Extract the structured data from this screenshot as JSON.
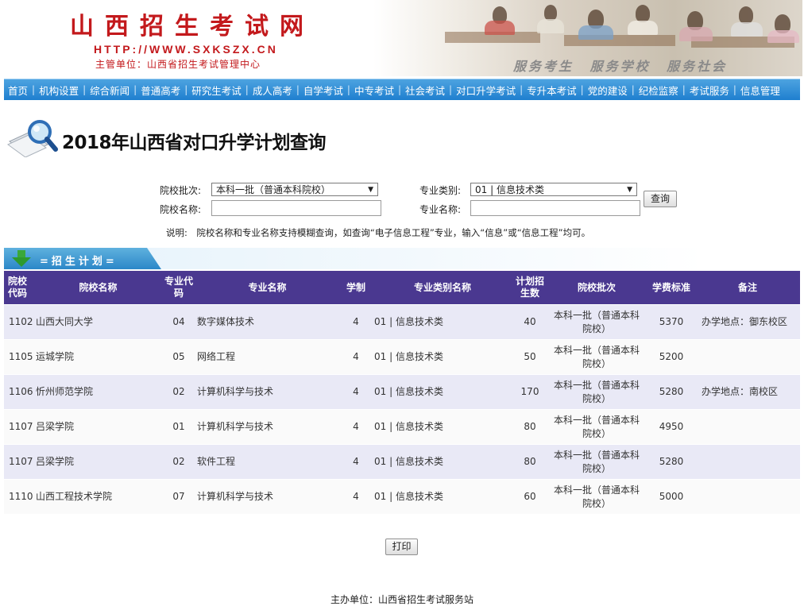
{
  "header": {
    "site_title": "山西招生考试网",
    "site_url": "HTTP://WWW.SXKSZX.CN",
    "site_sub": "主管单位：山西省招生考试管理中心",
    "slogan": "服务考生 服务学校 服务社会"
  },
  "nav": [
    "首页",
    "机构设置",
    "综合新闻",
    "普通高考",
    "研究生考试",
    "成人高考",
    "自学考试",
    "中专考试",
    "社会考试",
    "对口升学考试",
    "专升本考试",
    "党的建设",
    "纪检监察",
    "考试服务",
    "信息管理"
  ],
  "page_title": "2018年山西省对口升学计划查询",
  "form": {
    "batch_label": "院校批次:",
    "batch_value": "本科一批（普通本科院校）",
    "category_label": "专业类别:",
    "category_value": "01 | 信息技术类",
    "school_label": "院校名称:",
    "school_value": "",
    "major_label": "专业名称:",
    "major_value": "",
    "query_button": "查询",
    "note": "说明:　院校名称和专业名称支持模糊查询，如查询“电子信息工程”专业，输入“信息”或“信息工程”均可。"
  },
  "section_label": "=招生计划=",
  "table": {
    "headers": [
      "院校代码",
      "院校名称",
      "专业代码",
      "专业名称",
      "学制",
      "专业类别名称",
      "计划招生数",
      "院校批次",
      "学费标准",
      "备注"
    ],
    "rows": [
      [
        "1102",
        "山西大同大学",
        "04",
        "数字媒体技术",
        "4",
        "01 | 信息技术类",
        "40",
        "本科一批（普通本科院校）",
        "5370",
        "办学地点：御东校区"
      ],
      [
        "1105",
        "运城学院",
        "05",
        "网络工程",
        "4",
        "01 | 信息技术类",
        "50",
        "本科一批（普通本科院校）",
        "5200",
        ""
      ],
      [
        "1106",
        "忻州师范学院",
        "02",
        "计算机科学与技术",
        "4",
        "01 | 信息技术类",
        "170",
        "本科一批（普通本科院校）",
        "5280",
        "办学地点：南校区"
      ],
      [
        "1107",
        "吕梁学院",
        "01",
        "计算机科学与技术",
        "4",
        "01 | 信息技术类",
        "80",
        "本科一批（普通本科院校）",
        "4950",
        ""
      ],
      [
        "1107",
        "吕梁学院",
        "02",
        "软件工程",
        "4",
        "01 | 信息技术类",
        "80",
        "本科一批（普通本科院校）",
        "5280",
        ""
      ],
      [
        "1110",
        "山西工程技术学院",
        "07",
        "计算机科学与技术",
        "4",
        "01 | 信息技术类",
        "60",
        "本科一批（普通本科院校）",
        "5000",
        ""
      ]
    ]
  },
  "print_button": "打印",
  "footer": "主办单位：山西省招生考试服务站",
  "colors": {
    "brand_red": "#c3191c",
    "nav_blue": "#1f7fcf",
    "table_header": "#4a3890",
    "row_alt": "#e9e9f6"
  },
  "icons": {
    "title_icon": "magnifier-paper-icon",
    "section_icon": "green-down-arrow-icon"
  }
}
